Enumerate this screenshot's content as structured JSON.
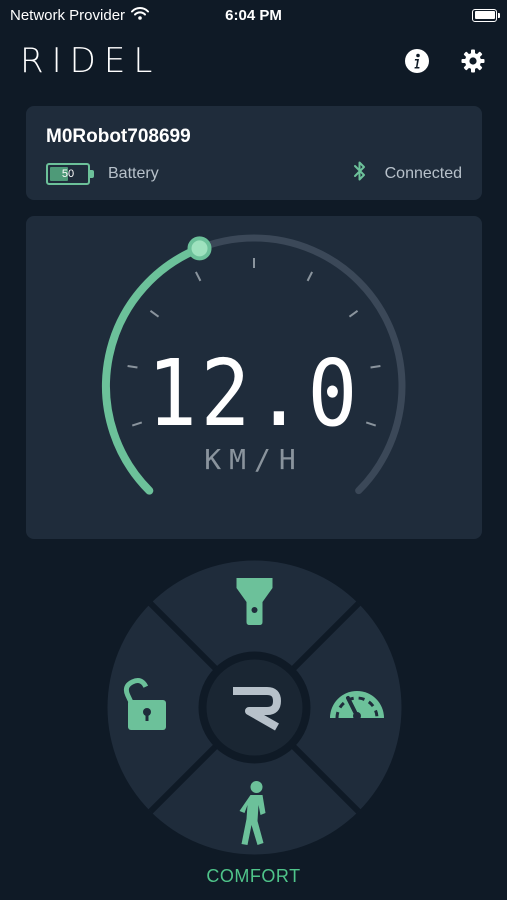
{
  "status_bar": {
    "carrier": "Network Provider",
    "time": "6:04 PM"
  },
  "header": {
    "logo": "RIDEL",
    "info_icon": "info-icon",
    "settings_icon": "gear-icon"
  },
  "device": {
    "name": "M0Robot708699",
    "battery_level": 50,
    "battery_label": "Battery",
    "connection_icon": "bluetooth-icon",
    "connection_status": "Connected"
  },
  "speedometer": {
    "value": "12.0",
    "unit": "KM/H",
    "gauge_fraction": 0.42,
    "colors": {
      "active": "#6cc19a",
      "track": "#3b4858"
    }
  },
  "controls": {
    "top": "flashlight-icon",
    "left": "unlock-icon",
    "right": "speed-gauge-icon",
    "bottom": "walking-person-icon",
    "center": "ridel-logo-icon"
  },
  "mode": "COMFORT",
  "colors": {
    "background": "#0f1a26",
    "card": "#1f2c3b",
    "accent": "#6cc19a",
    "mode": "#4fc48a"
  }
}
